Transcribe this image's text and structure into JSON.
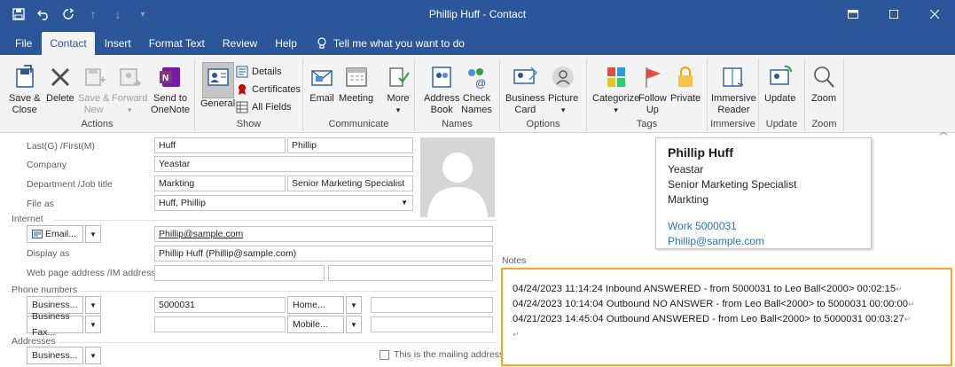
{
  "window": {
    "title": "Phillip Huff  -  Contact"
  },
  "tabs": [
    "File",
    "Contact",
    "Insert",
    "Format Text",
    "Review",
    "Help"
  ],
  "tell_me": "Tell me what you want to do",
  "ribbon": {
    "actions": {
      "save_close": [
        "Save &",
        "Close"
      ],
      "delete": "Delete",
      "save_new": [
        "Save &",
        "New"
      ],
      "forward": "Forward",
      "send_onenote": [
        "Send to",
        "OneNote"
      ],
      "label": "Actions"
    },
    "show": {
      "general": "General",
      "details": "Details",
      "certificates": "Certificates",
      "all_fields": "All Fields",
      "label": "Show"
    },
    "communicate": {
      "email": "Email",
      "meeting": "Meeting",
      "more": "More",
      "label": "Communicate"
    },
    "names": {
      "address_book": [
        "Address",
        "Book"
      ],
      "check_names": [
        "Check",
        "Names"
      ],
      "label": "Names"
    },
    "options": {
      "business_card": [
        "Business",
        "Card"
      ],
      "picture": "Picture",
      "label": "Options"
    },
    "tags": {
      "categorize": "Categorize",
      "follow_up": [
        "Follow",
        "Up"
      ],
      "private": "Private",
      "label": "Tags"
    },
    "immersive": {
      "reader": [
        "Immersive",
        "Reader"
      ],
      "label": "Immersive"
    },
    "update": {
      "update": "Update",
      "label": "Update"
    },
    "zoom": {
      "zoom": "Zoom",
      "label": "Zoom"
    }
  },
  "form": {
    "labels": {
      "name": "Last(G)  /First(M)",
      "company": "Company",
      "dept_job": "Department  /Job title",
      "file_as": "File as",
      "internet": "Internet",
      "display_as": "Display as",
      "web_im": "Web page address  /IM address",
      "phone_numbers": "Phone numbers",
      "addresses": "Addresses",
      "mailing": "This is the mailing address",
      "notes": "Notes"
    },
    "values": {
      "last": "Huff",
      "first": "Phillip",
      "company": "Yeastar",
      "department": "Markting",
      "job_title": "Senior Marketing Specialist",
      "file_as": "Huff, Phillip",
      "email_button": "Email...",
      "email": "Phillip@sample.com",
      "display_as": "Phillip Huff (Phillip@sample.com)",
      "web": "",
      "im": "",
      "phone1_type": "Business...",
      "phone1": "5000031",
      "phone2_type": "Home...",
      "phone2": "",
      "phone3_type": "Business Fax...",
      "phone3": "",
      "phone4_type": "Mobile...",
      "phone4": "",
      "address_type": "Business..."
    }
  },
  "business_card": {
    "name": "Phillip Huff",
    "company": "Yeastar",
    "title": "Senior Marketing Specialist",
    "department": "Markting",
    "work_label": "Work",
    "work_phone": "5000031",
    "email": "Phillip@sample.com"
  },
  "notes": [
    "04/24/2023 11:14:24 Inbound ANSWERED - from  5000031 to    Leo Ball<2000> 00:02:15",
    "04/24/2023 10:14:04 Outbound NO ANSWER - from    Leo Ball<2000> to 5000031 00:00:00",
    "04/21/2023 14:45:04 Outbound ANSWERED - from    Leo Ball<2000> to 5000031 00:03:27",
    ""
  ],
  "colors": {
    "brand": "#2b579a",
    "notes_highlight": "#f5a623",
    "link": "#2e75b6"
  }
}
